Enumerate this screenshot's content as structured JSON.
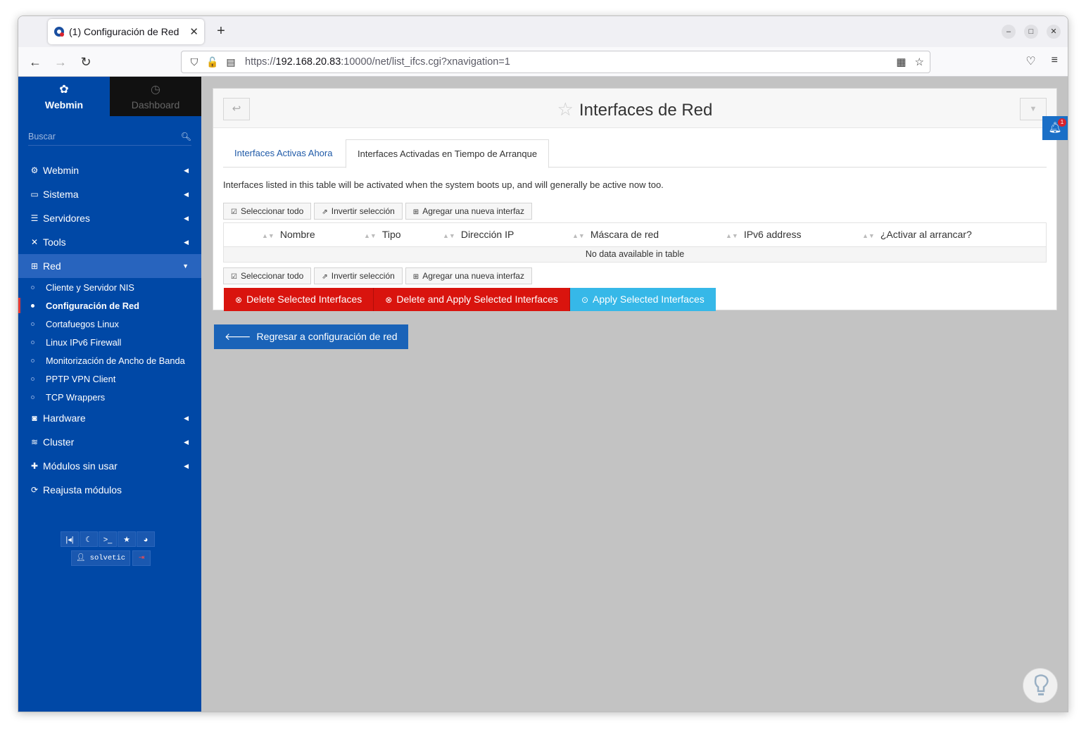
{
  "browser": {
    "tab_title": "(1) Configuración de Red",
    "new_tab": "+",
    "url_scheme": "https://",
    "url_host": "192.168.20.83",
    "url_rest": ":10000/net/list_ifcs.cgi?xnavigation=1"
  },
  "sidebar": {
    "top_tabs": [
      {
        "label": "Webmin",
        "icon": "webmin-logo-icon"
      },
      {
        "label": "Dashboard",
        "icon": "dashboard-gauge-icon"
      }
    ],
    "search_placeholder": "Buscar",
    "menu": [
      {
        "label": "Webmin",
        "icon": "gear-icon"
      },
      {
        "label": "Sistema",
        "icon": "laptop-icon"
      },
      {
        "label": "Servidores",
        "icon": "server-icon"
      },
      {
        "label": "Tools",
        "icon": "tools-icon"
      },
      {
        "label": "Red",
        "icon": "network-icon"
      }
    ],
    "red_submenu": [
      "Cliente y Servidor NIS",
      "Configuración de Red",
      "Cortafuegos Linux",
      "Linux IPv6 Firewall",
      "Monitorización de Ancho de Banda",
      "PPTP VPN Client",
      "TCP Wrappers"
    ],
    "menu_after": [
      {
        "label": "Hardware",
        "icon": "hdd-icon"
      },
      {
        "label": "Cluster",
        "icon": "layers-icon"
      },
      {
        "label": "Módulos sin usar",
        "icon": "puzzle-icon"
      },
      {
        "label": "Reajusta módulos",
        "icon": "refresh-icon"
      }
    ],
    "user": "solvetic"
  },
  "panel": {
    "title": "Interfaces de Red",
    "tabs": [
      "Interfaces Activas Ahora",
      "Interfaces Activadas en Tiempo de Arranque"
    ],
    "description": "Interfaces listed in this table will be activated when the system boots up, and will generally be active now too.",
    "buttons": {
      "select_all": "Seleccionar todo",
      "invert": "Invertir selección",
      "add": "Agregar una nueva interfaz"
    },
    "columns": [
      "Nombre",
      "Tipo",
      "Dirección IP",
      "Máscara de red",
      "IPv6 address",
      "¿Activar al arrancar?"
    ],
    "empty_message": "No data available in table",
    "actions": {
      "delete": "Delete Selected Interfaces",
      "delete_apply": "Delete and Apply Selected Interfaces",
      "apply": "Apply Selected Interfaces"
    },
    "notification_count": "1"
  },
  "return_button": "Regresar a configuración de red",
  "colors": {
    "sidebar": "#0048a6",
    "danger": "#d9140e",
    "info": "#36b8e8",
    "primary": "#1a63b8"
  }
}
